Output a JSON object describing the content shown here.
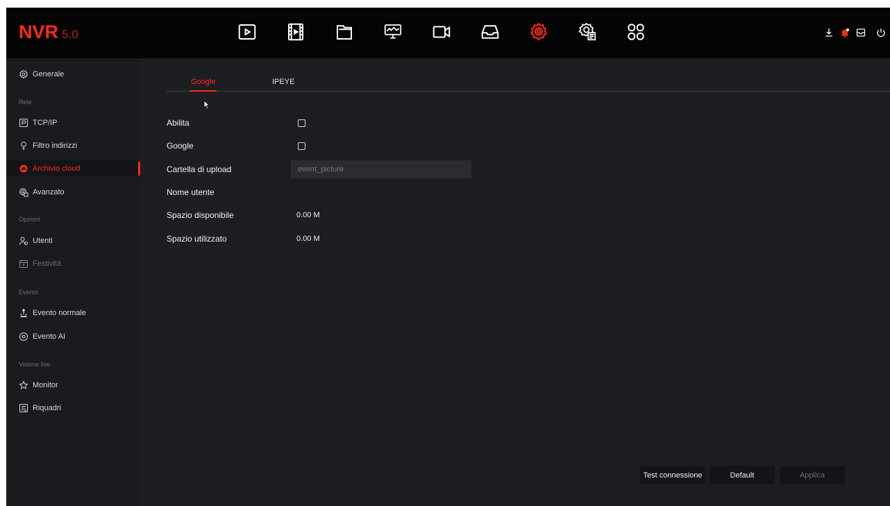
{
  "app": {
    "brand": "NVR",
    "version": "5.0"
  },
  "topnav": [
    {
      "name": "playback-icon"
    },
    {
      "name": "video-clip-icon"
    },
    {
      "name": "files-icon"
    },
    {
      "name": "monitor-icon"
    },
    {
      "name": "camera-icon"
    },
    {
      "name": "storage-icon"
    },
    {
      "name": "settings-icon",
      "active": true
    },
    {
      "name": "system-settings-icon"
    },
    {
      "name": "apps-grid-icon"
    }
  ],
  "topright": [
    {
      "name": "download-icon"
    },
    {
      "name": "alarm-icon"
    },
    {
      "name": "message-icon"
    },
    {
      "name": "power-icon"
    }
  ],
  "colors": {
    "accent": "#ff2a1a",
    "bg": "#1c1e22",
    "topbar": "#050505",
    "sidebar": "#1a1b1f"
  },
  "sidebar": {
    "top_item": {
      "label": "Generale",
      "icon": "general-settings-icon"
    },
    "sections": {
      "rete": "Rete",
      "opzioni": "Opzioni",
      "evento": "Evento",
      "visione_live": "Visione live"
    },
    "items": {
      "tcpip": {
        "label": "TCP/IP",
        "icon": "p-box-icon"
      },
      "filtro": {
        "label": "Filtro indirizzi",
        "icon": "filter-icon"
      },
      "cloud": {
        "label": "Archivio cloud",
        "icon": "cloud-icon",
        "active": true
      },
      "avanzato": {
        "label": "Avanzato",
        "icon": "advanced-icon"
      },
      "utenti": {
        "label": "Utenti",
        "icon": "users-icon"
      },
      "festivita": {
        "label": "Festività",
        "icon": "calendar-icon",
        "disabled": true
      },
      "evento_normale": {
        "label": "Evento normale",
        "icon": "event-icon"
      },
      "evento_ai": {
        "label": "Evento AI",
        "icon": "ai-event-icon"
      },
      "monitor": {
        "label": "Monitor",
        "icon": "star-icon"
      },
      "riquadri": {
        "label": "Riquadri",
        "icon": "layout-icon"
      }
    }
  },
  "tabs": {
    "google": "Google",
    "ipeye": "IPEYE"
  },
  "form": {
    "abilita": "Abilita",
    "google": "Google",
    "cartella": "Cartella di upload",
    "cartella_placeholder": "event_picture",
    "nome_utente": "Nome utente",
    "spazio_disponibile": "Spazio disponibile",
    "spazio_disponibile_value": "0.00 M",
    "spazio_utilizzato": "Spazio utilizzato",
    "spazio_utilizzato_value": "0.00 M"
  },
  "buttons": {
    "test": "Test connessione",
    "default": "Default",
    "applica": "Applica"
  }
}
